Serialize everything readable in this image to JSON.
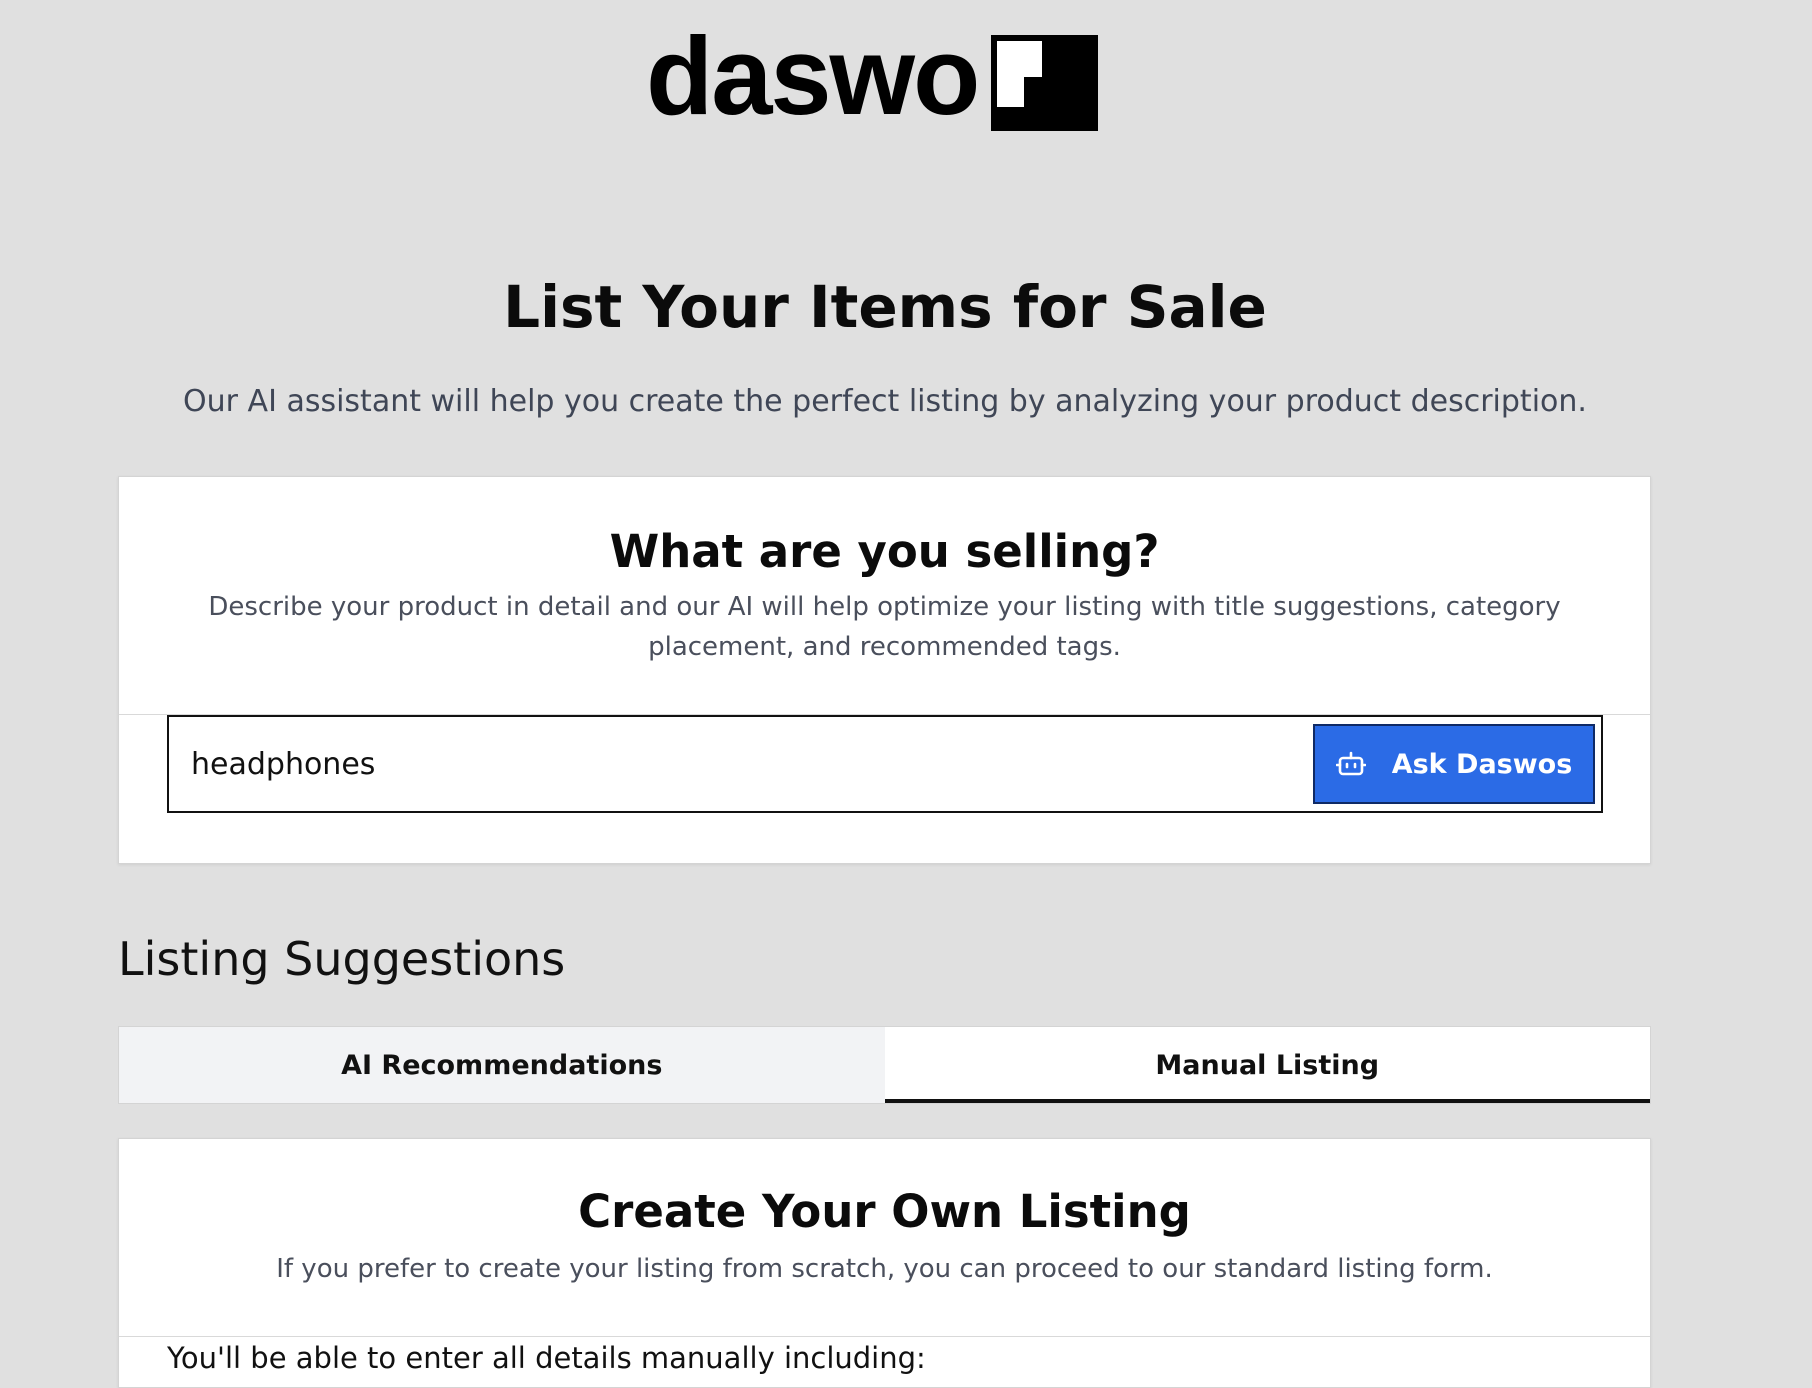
{
  "brand": {
    "logo_text": "daswo"
  },
  "header": {
    "title": "List Your Items for Sale",
    "subtitle": "Our AI assistant will help you create the perfect listing by analyzing your product description."
  },
  "sell_card": {
    "title": "What are you selling?",
    "description": "Describe your product in detail and our AI will help optimize your listing with title suggestions, category placement, and recommended tags.",
    "input_value": "headphones",
    "ask_button_label": "Ask Daswos",
    "ask_button_icon": "robot-icon"
  },
  "suggestions": {
    "title": "Listing Suggestions",
    "tabs": [
      {
        "label": "AI Recommendations",
        "active": false
      },
      {
        "label": "Manual Listing",
        "active": true
      }
    ]
  },
  "own_listing_card": {
    "title": "Create Your Own Listing",
    "description": "If you prefer to create your listing from scratch, you can proceed to our standard listing form.",
    "body_text": "You'll be able to enter all details manually including:"
  },
  "colors": {
    "page_background": "#e0e0e0",
    "accent": "#2b6be6",
    "text": "#0b0b0b",
    "muted_text": "#4a4f5c"
  }
}
